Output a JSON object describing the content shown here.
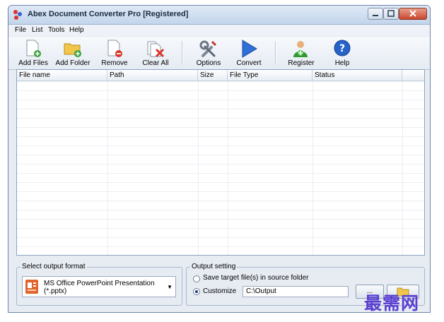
{
  "window": {
    "title": "Abex Document Converter Pro [Registered]"
  },
  "menu": [
    "File",
    "List",
    "Tools",
    "Help"
  ],
  "toolbar": {
    "add_files": "Add Files",
    "add_folder": "Add Folder",
    "remove": "Remove",
    "clear_all": "Clear All",
    "options": "Options",
    "convert": "Convert",
    "register": "Register",
    "help": "Help"
  },
  "list": {
    "columns": [
      "File name",
      "Path",
      "Size",
      "File Type",
      "Status"
    ],
    "rows": []
  },
  "output_format": {
    "label": "Select output format",
    "selected_line1": "MS Office PowerPoint Presentation",
    "selected_line2": "(*.pptx)"
  },
  "output_setting": {
    "label": "Output setting",
    "option_source": "Save target file(s) in source folder",
    "option_custom": "Customize",
    "selected": "Customize",
    "path": "C:\\Output",
    "browse_label": "..."
  },
  "watermark": "最需网",
  "colors": {
    "convert_arrow": "#2f6fd8",
    "help_circle": "#2563c9",
    "title_bar": "#c3d5ec"
  }
}
